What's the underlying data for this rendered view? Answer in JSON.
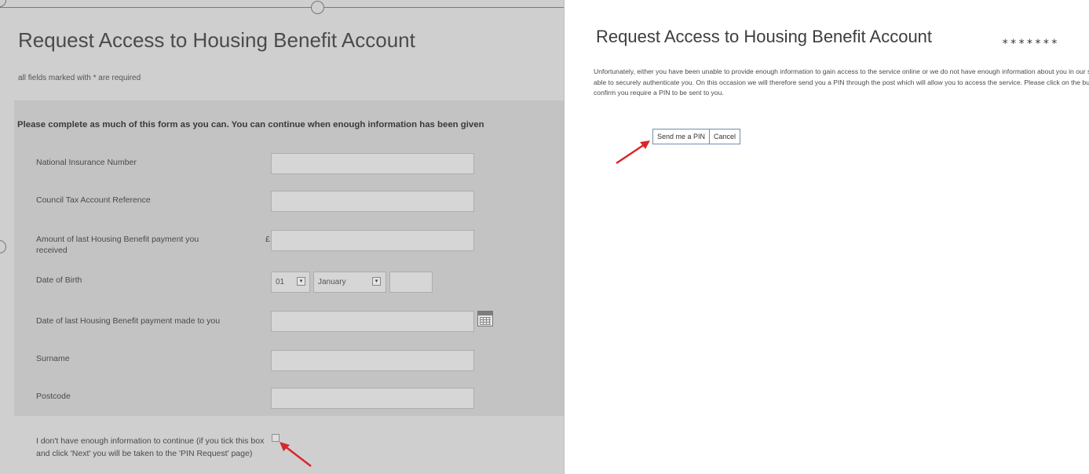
{
  "left": {
    "title": "Request Access to Housing Benefit Account",
    "required_note": "all fields marked with * are required",
    "instruction": "Please complete as much of this form as you can. You can continue when enough information has been given",
    "fields": {
      "ni_number": "National Insurance Number",
      "council_tax_ref": "Council Tax Account Reference",
      "last_payment_amount": "Amount of last Housing Benefit payment you received",
      "currency_symbol": "£",
      "dob": "Date of Birth",
      "dob_day": "01",
      "dob_month": "January",
      "last_payment_date": "Date of last Housing Benefit payment made to you",
      "surname": "Surname",
      "postcode": "Postcode"
    },
    "no_info_checkbox_label": "I don't have enough information to continue (if you tick this box and click 'Next' you will be taken to the 'PIN Request' page)"
  },
  "right": {
    "title": "Request Access to Housing Benefit Account",
    "stars": "*******",
    "message": "Unfortunately, either you have been unable to provide enough information to gain access to the service online or we do not have enough information about you in our system to be able to securely authenticate you. On this occasion we will therefore send you a PIN through the post which will allow you to access the service. Please click on the button to confirm you require a PIN to be sent to you.",
    "send_pin_label": "Send me a PIN",
    "cancel_label": "Cancel"
  },
  "colors": {
    "annotation_arrow": "#d9262a",
    "button_border": "#6f8fb0"
  }
}
